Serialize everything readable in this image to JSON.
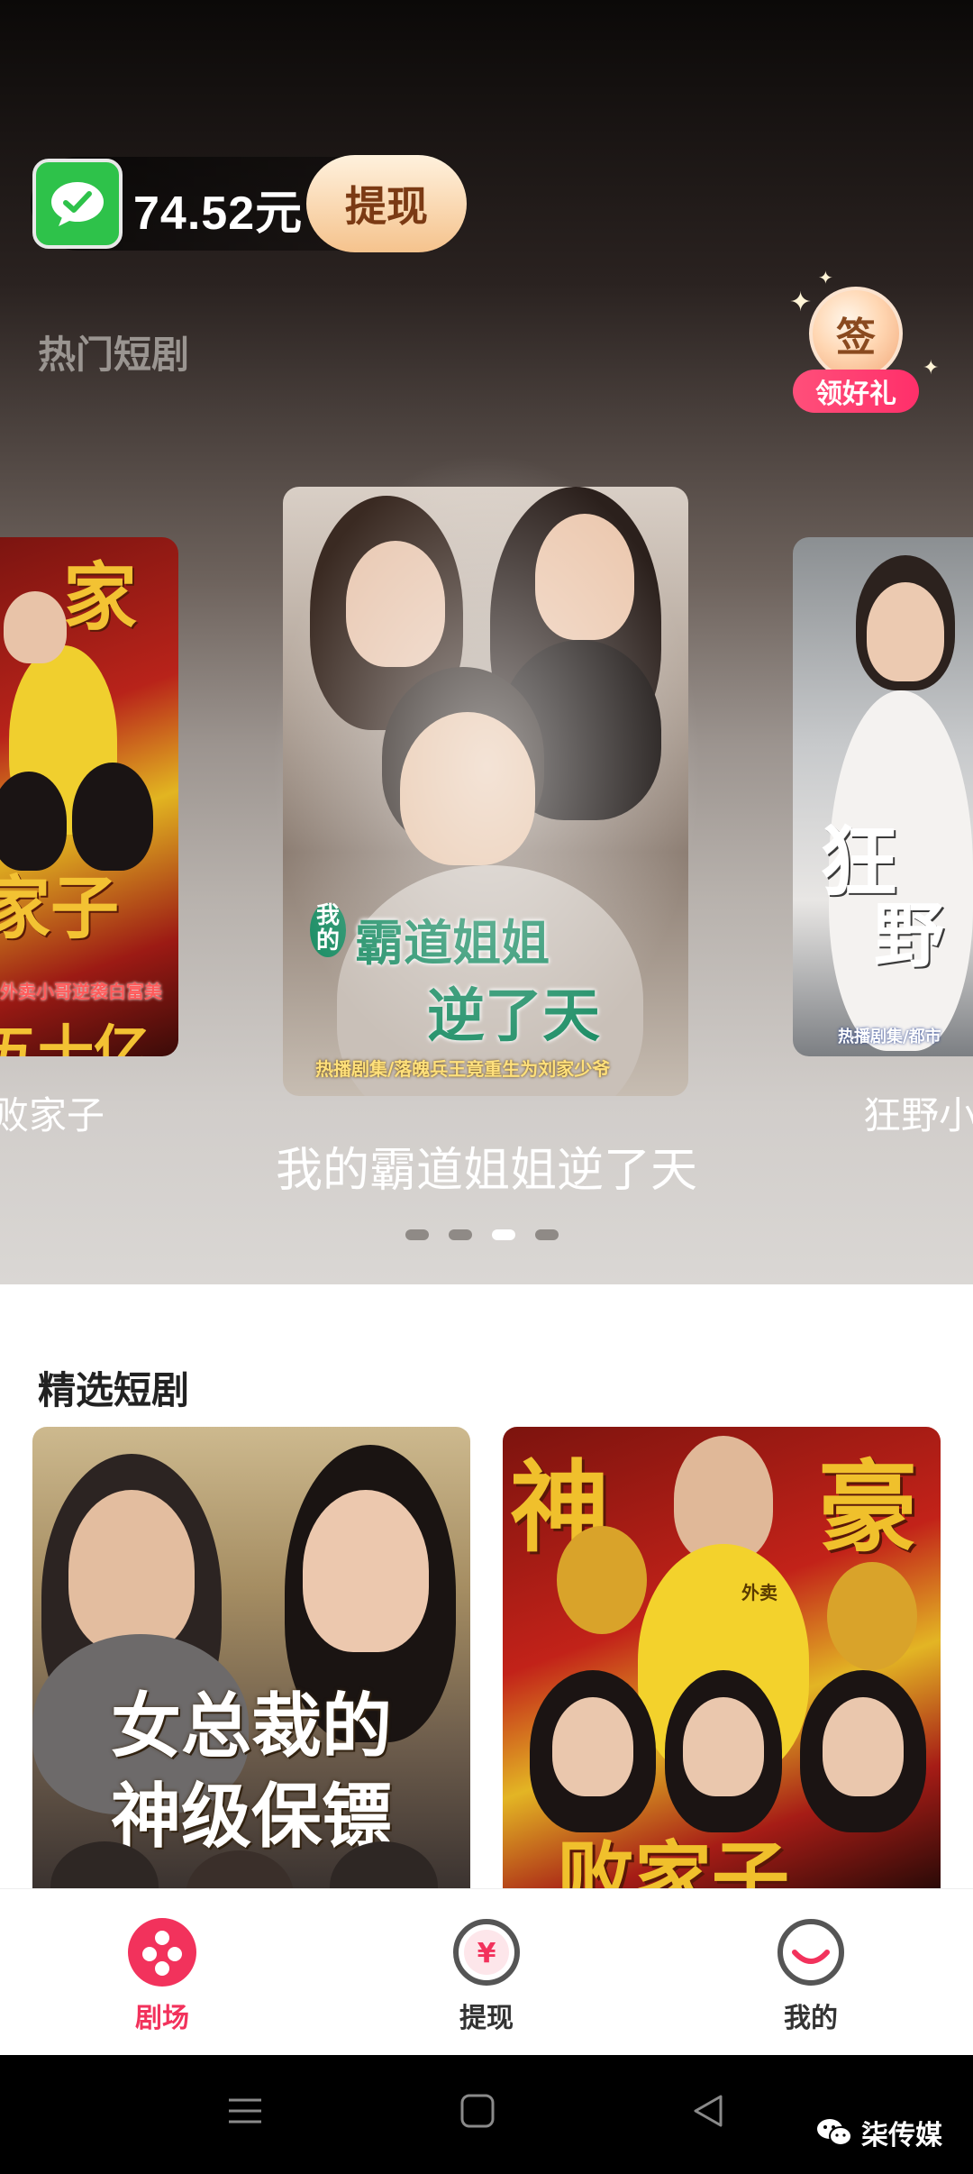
{
  "balance": {
    "amount": "74.52元",
    "withdraw_label": "提现",
    "wechat_icon": "wechat-icon"
  },
  "hot": {
    "title": "热门短剧",
    "signin": {
      "glyph": "签",
      "label": "领好礼"
    },
    "cards": [
      {
        "caption": "败家子",
        "poster_chars": [
          "家",
          "家子",
          "五十亿"
        ],
        "tag": "外卖小哥逆袭白富美"
      },
      {
        "caption": "我的霸道姐姐逆了天",
        "poster_prefix": "我的",
        "poster_line1": "霸道姐姐",
        "poster_line2": "逆了天",
        "tag": "热播剧集/落魄兵王竟重生为刘家少爷"
      },
      {
        "caption": "狂野小",
        "poster_chars": [
          "狂",
          "野"
        ],
        "tag": "热播剧集/都市"
      }
    ],
    "dots": {
      "count": 4,
      "active_index": 2
    }
  },
  "selected": {
    "title": "精选短剧",
    "tiles": [
      {
        "poster_line1": "女总裁的",
        "poster_line2": "神级保镖"
      },
      {
        "poster_chars": [
          "神",
          "豪",
          "败家子"
        ],
        "badge": "外卖"
      }
    ]
  },
  "nav": {
    "items": [
      {
        "label": "剧场",
        "icon": "film-reel-icon",
        "active": true
      },
      {
        "label": "提现",
        "icon": "yen-coin-icon",
        "active": false
      },
      {
        "label": "我的",
        "icon": "smile-icon",
        "active": false
      }
    ]
  },
  "watermark": "柒传媒",
  "colors": {
    "accent": "#f2325c",
    "wechat_green": "#2ec24a",
    "withdraw_text": "#7b3a14"
  }
}
